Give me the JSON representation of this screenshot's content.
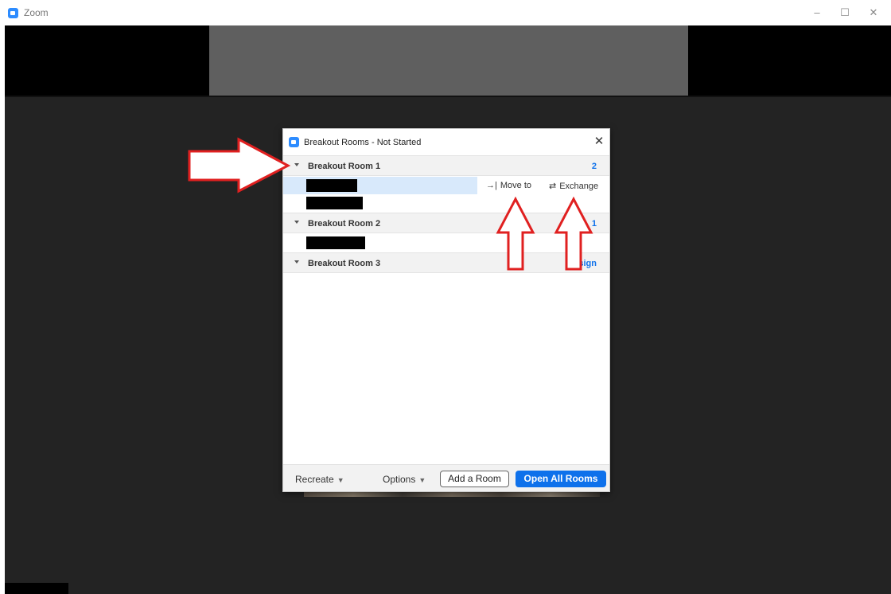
{
  "window": {
    "title": "Zoom",
    "minimize_icon": "–",
    "maximize_icon": "☐",
    "close_icon": "✕"
  },
  "dialog": {
    "title": "Breakout Rooms - Not Started",
    "close_icon": "✕",
    "rooms": [
      {
        "name": "Breakout Room 1",
        "count": "2",
        "participants": 2
      },
      {
        "name": "Breakout Room 2",
        "count": "1",
        "participants": 1
      },
      {
        "name": "Breakout Room 3",
        "count": "Assign",
        "participants": 0
      }
    ],
    "row_actions": {
      "move_to": "Move to",
      "move_to_icon": "→|",
      "exchange": "Exchange",
      "exchange_icon": "⇄"
    },
    "footer": {
      "recreate": "Recreate",
      "options": "Options",
      "add_room": "Add a Room",
      "open_all": "Open All Rooms"
    }
  },
  "colors": {
    "accent": "#0e71eb",
    "annotation_arrow": "#e02020",
    "meeting_bg": "#232323"
  }
}
